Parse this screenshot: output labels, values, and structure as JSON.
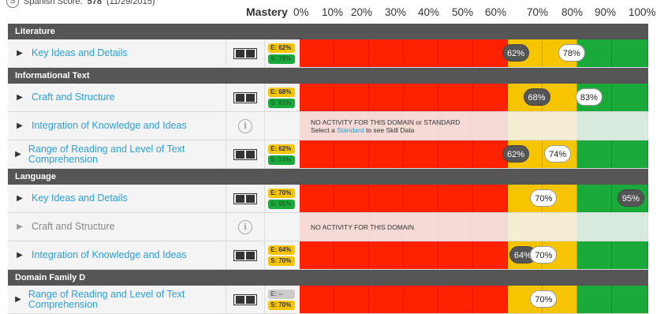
{
  "top_note": {
    "icon": "S",
    "prefix": "Spanish Score:",
    "score": "578",
    "date": "(11/29/2015)"
  },
  "mastery": {
    "title": "Mastery",
    "ticks": [
      "0%",
      "10%",
      "20%",
      "30%",
      "40%",
      "50%",
      "60%",
      "70%",
      "80%",
      "90%",
      "100%"
    ]
  },
  "info_glyph": "i",
  "no_activity": {
    "line1": "NO ACTIVITY FOR THIS DOMAIN or STANDARD",
    "line2_pre": "Select a",
    "line2_link": "Standard",
    "line2_post": "to see Skill Data",
    "domain_only": "NO ACTIVITY FOR THIS DOMAIN"
  },
  "colors": {
    "red": "#ff2200",
    "yellow": "#f7c500",
    "green": "#1aaa3c",
    "link": "#2aa0d8",
    "section": "#555555"
  },
  "sections": [
    {
      "title": "Literature",
      "rows": [
        {
          "label": "Key Ideas and Details",
          "e": "E: 62%",
          "s": "S: 78%",
          "pills": [
            {
              "v": 62,
              "t": "62%",
              "dark": true
            },
            {
              "v": 78,
              "t": "78%",
              "dark": false
            }
          ],
          "state": "active"
        }
      ]
    },
    {
      "title": "Informational Text",
      "rows": [
        {
          "label": "Craft and Structure",
          "e": "E: 68%",
          "s": "S: 83%",
          "pills": [
            {
              "v": 68,
              "t": "68%",
              "dark": true
            },
            {
              "v": 83,
              "t": "83%",
              "dark": false
            }
          ],
          "state": "active"
        },
        {
          "label": "Integration of Knowledge and Ideas",
          "state": "noactivity-standard"
        },
        {
          "label": "Range of Reading and Level of Text Comprehension",
          "e": "E: 62%",
          "s": "S: 74%",
          "pills": [
            {
              "v": 62,
              "t": "62%",
              "dark": true
            },
            {
              "v": 74,
              "t": "74%",
              "dark": false
            }
          ],
          "state": "active"
        }
      ]
    },
    {
      "title": "Language",
      "rows": [
        {
          "label": "Key Ideas and Details",
          "e": "E: 70%",
          "s": "S: 95%",
          "pills": [
            {
              "v": 70,
              "t": "70%",
              "dark": false
            },
            {
              "v": 95,
              "t": "95%",
              "dark": true
            }
          ],
          "state": "active"
        },
        {
          "label": "Craft and Structure",
          "state": "noactivity-domain"
        },
        {
          "label": "Integration of Knowledge and Ideas",
          "e": "E: 64%",
          "s": "S: 70%",
          "s_yellow": true,
          "pills": [
            {
              "v": 64,
              "t": "64%",
              "dark": true
            },
            {
              "v": 70,
              "t": "70%",
              "dark": false
            }
          ],
          "state": "active"
        }
      ]
    },
    {
      "title": "Domain Family D",
      "rows": [
        {
          "label": "Range of Reading and Level of Text Comprehension",
          "e": "E: --",
          "s": "S: 70%",
          "e_gray": true,
          "s_yellow": true,
          "pills": [
            {
              "v": 70,
              "t": "70%",
              "dark": false
            }
          ],
          "state": "active"
        }
      ]
    }
  ]
}
